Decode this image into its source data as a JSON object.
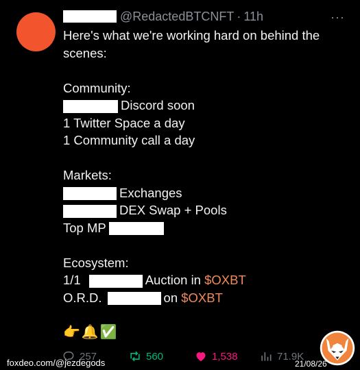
{
  "tweet": {
    "handle": "@RedactedBTCNFT",
    "separator": "·",
    "time": "11h",
    "more": "···",
    "lines": {
      "intro1": "Here's what we're working hard on behind the",
      "intro2": "scenes:",
      "community_header": "Community:",
      "discord": "Discord soon",
      "twitter_space": "1 Twitter Space a day",
      "community_call": "1 Community call a day",
      "markets_header": "Markets:",
      "exchanges": "Exchanges",
      "dex": "DEX Swap + Pools",
      "top_mp": "Top MP",
      "ecosystem_header": "Ecosystem:",
      "one_one": "1/1",
      "auction_in": "Auction in",
      "token": "$OXBT",
      "ord": "O.R.D.",
      "on": "on",
      "emojis": "👉🔔✅"
    }
  },
  "actions": {
    "replies": "257",
    "retweets": "560",
    "likes": "1,538",
    "views": "71.9K"
  },
  "watermark": {
    "text": "foxdeo.com/@jezdegods",
    "date": "21/08/26"
  },
  "colors": {
    "avatar": "#f2542d",
    "token": "#f08a5d",
    "retweet": "#00ba7c",
    "like": "#f91880",
    "muted": "#6e767d"
  }
}
